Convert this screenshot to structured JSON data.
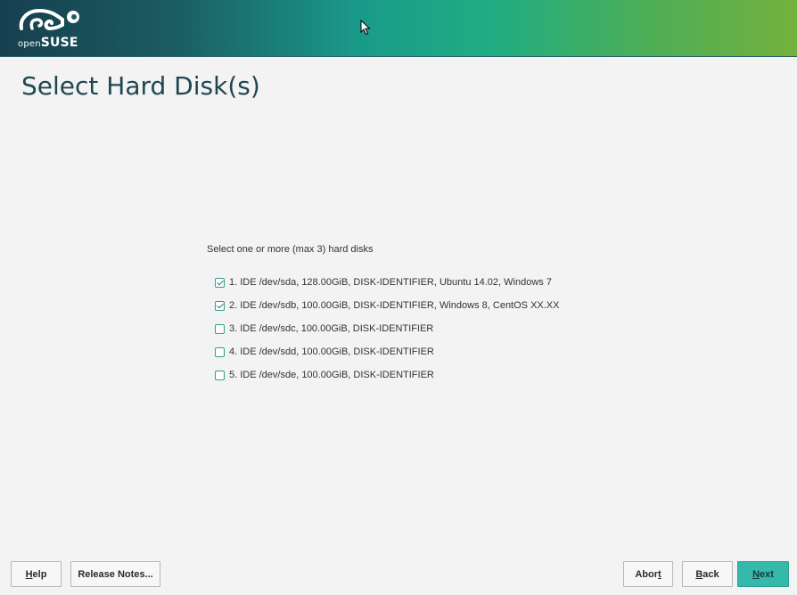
{
  "header": {
    "logo": {
      "prefix": "open",
      "brand": "SUSE",
      "icon": "chameleon-logo-icon"
    },
    "gradient_colors": [
      "#173f4f",
      "#1a9a8a",
      "#73b23d"
    ]
  },
  "page": {
    "title": "Select Hard Disk(s)"
  },
  "main": {
    "instruction": "Select one or more (max 3) hard disks",
    "disks": [
      {
        "label": "1. IDE /dev/sda, 128.00GiB, DISK-IDENTIFIER, Ubuntu 14.02, Windows 7",
        "checked": true
      },
      {
        "label": "2. IDE /dev/sdb, 100.00GiB, DISK-IDENTIFIER, Windows 8, CentOS XX.XX",
        "checked": true
      },
      {
        "label": "3. IDE /dev/sdc, 100.00GiB, DISK-IDENTIFIER",
        "checked": false
      },
      {
        "label": "4. IDE /dev/sdd, 100.00GiB, DISK-IDENTIFIER",
        "checked": false
      },
      {
        "label": "5. IDE /dev/sde, 100.00GiB, DISK-IDENTIFIER",
        "checked": false
      }
    ]
  },
  "footer": {
    "help": {
      "mnemonic": "H",
      "rest": "elp"
    },
    "release_notes": {
      "label": "Release Notes..."
    },
    "abort": {
      "prefix": "Abor",
      "mnemonic": "t"
    },
    "back": {
      "mnemonic": "B",
      "rest": "ack"
    },
    "next": {
      "mnemonic": "N",
      "rest": "ext"
    }
  },
  "colors": {
    "accent": "#35b9ab",
    "title": "#1f4752",
    "background": "#f3f3f3"
  }
}
